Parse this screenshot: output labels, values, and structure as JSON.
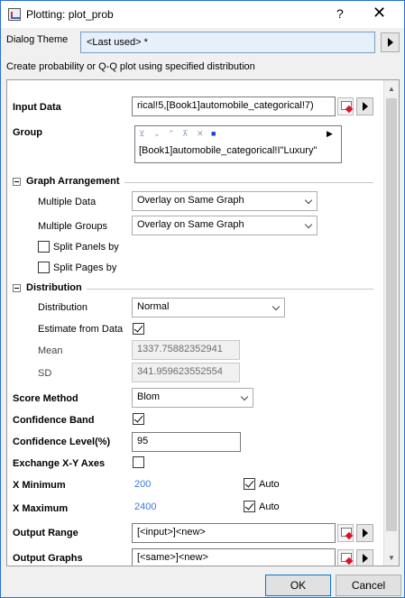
{
  "window": {
    "title": "Plotting: plot_prob",
    "help": "?",
    "close": "✕"
  },
  "theme": {
    "label": "Dialog Theme",
    "value": "<Last used> *"
  },
  "description": "Create probability or Q-Q plot using specified distribution",
  "input_data": {
    "label": "Input Data",
    "value": "rical!5,[Book1]automobile_categorical!7)"
  },
  "group": {
    "label": "Group",
    "tools": [
      "⊻",
      "⌄",
      "⌃",
      "⊼",
      "✕",
      "■",
      "▶"
    ],
    "item": "[Book1]automobile_categorical!I\"Luxury\""
  },
  "graph_arrangement": {
    "label": "Graph Arrangement",
    "multiple_data": {
      "label": "Multiple Data",
      "value": "Overlay on Same Graph"
    },
    "multiple_groups": {
      "label": "Multiple Groups",
      "value": "Overlay on Same Graph"
    },
    "split_panels": {
      "label": "Split Panels by",
      "checked": false
    },
    "split_pages": {
      "label": "Split Pages by",
      "checked": false
    }
  },
  "distribution": {
    "label": "Distribution",
    "type": {
      "label": "Distribution",
      "value": "Normal"
    },
    "estimate": {
      "label": "Estimate from Data",
      "checked": true
    },
    "mean": {
      "label": "Mean",
      "value": "1337.75882352941"
    },
    "sd": {
      "label": "SD",
      "value": "341.959623552554"
    }
  },
  "score_method": {
    "label": "Score Method",
    "value": "Blom"
  },
  "confidence_band": {
    "label": "Confidence Band",
    "checked": true
  },
  "confidence_level": {
    "label": "Confidence Level(%)",
    "value": "95"
  },
  "exchange_axes": {
    "label": "Exchange X-Y Axes",
    "checked": false
  },
  "x_minimum": {
    "label": "X Minimum",
    "value": "200",
    "auto_label": "Auto",
    "auto": true
  },
  "x_maximum": {
    "label": "X Maximum",
    "value": "2400",
    "auto_label": "Auto",
    "auto": true
  },
  "output_range": {
    "label": "Output Range",
    "value": "[<input>]<new>"
  },
  "output_graphs": {
    "label": "Output Graphs",
    "value": "[<same>]<new>"
  },
  "buttons": {
    "ok": "OK",
    "cancel": "Cancel"
  },
  "colors": {
    "accent": "#0078d7",
    "link_value": "#3c7bd6"
  }
}
